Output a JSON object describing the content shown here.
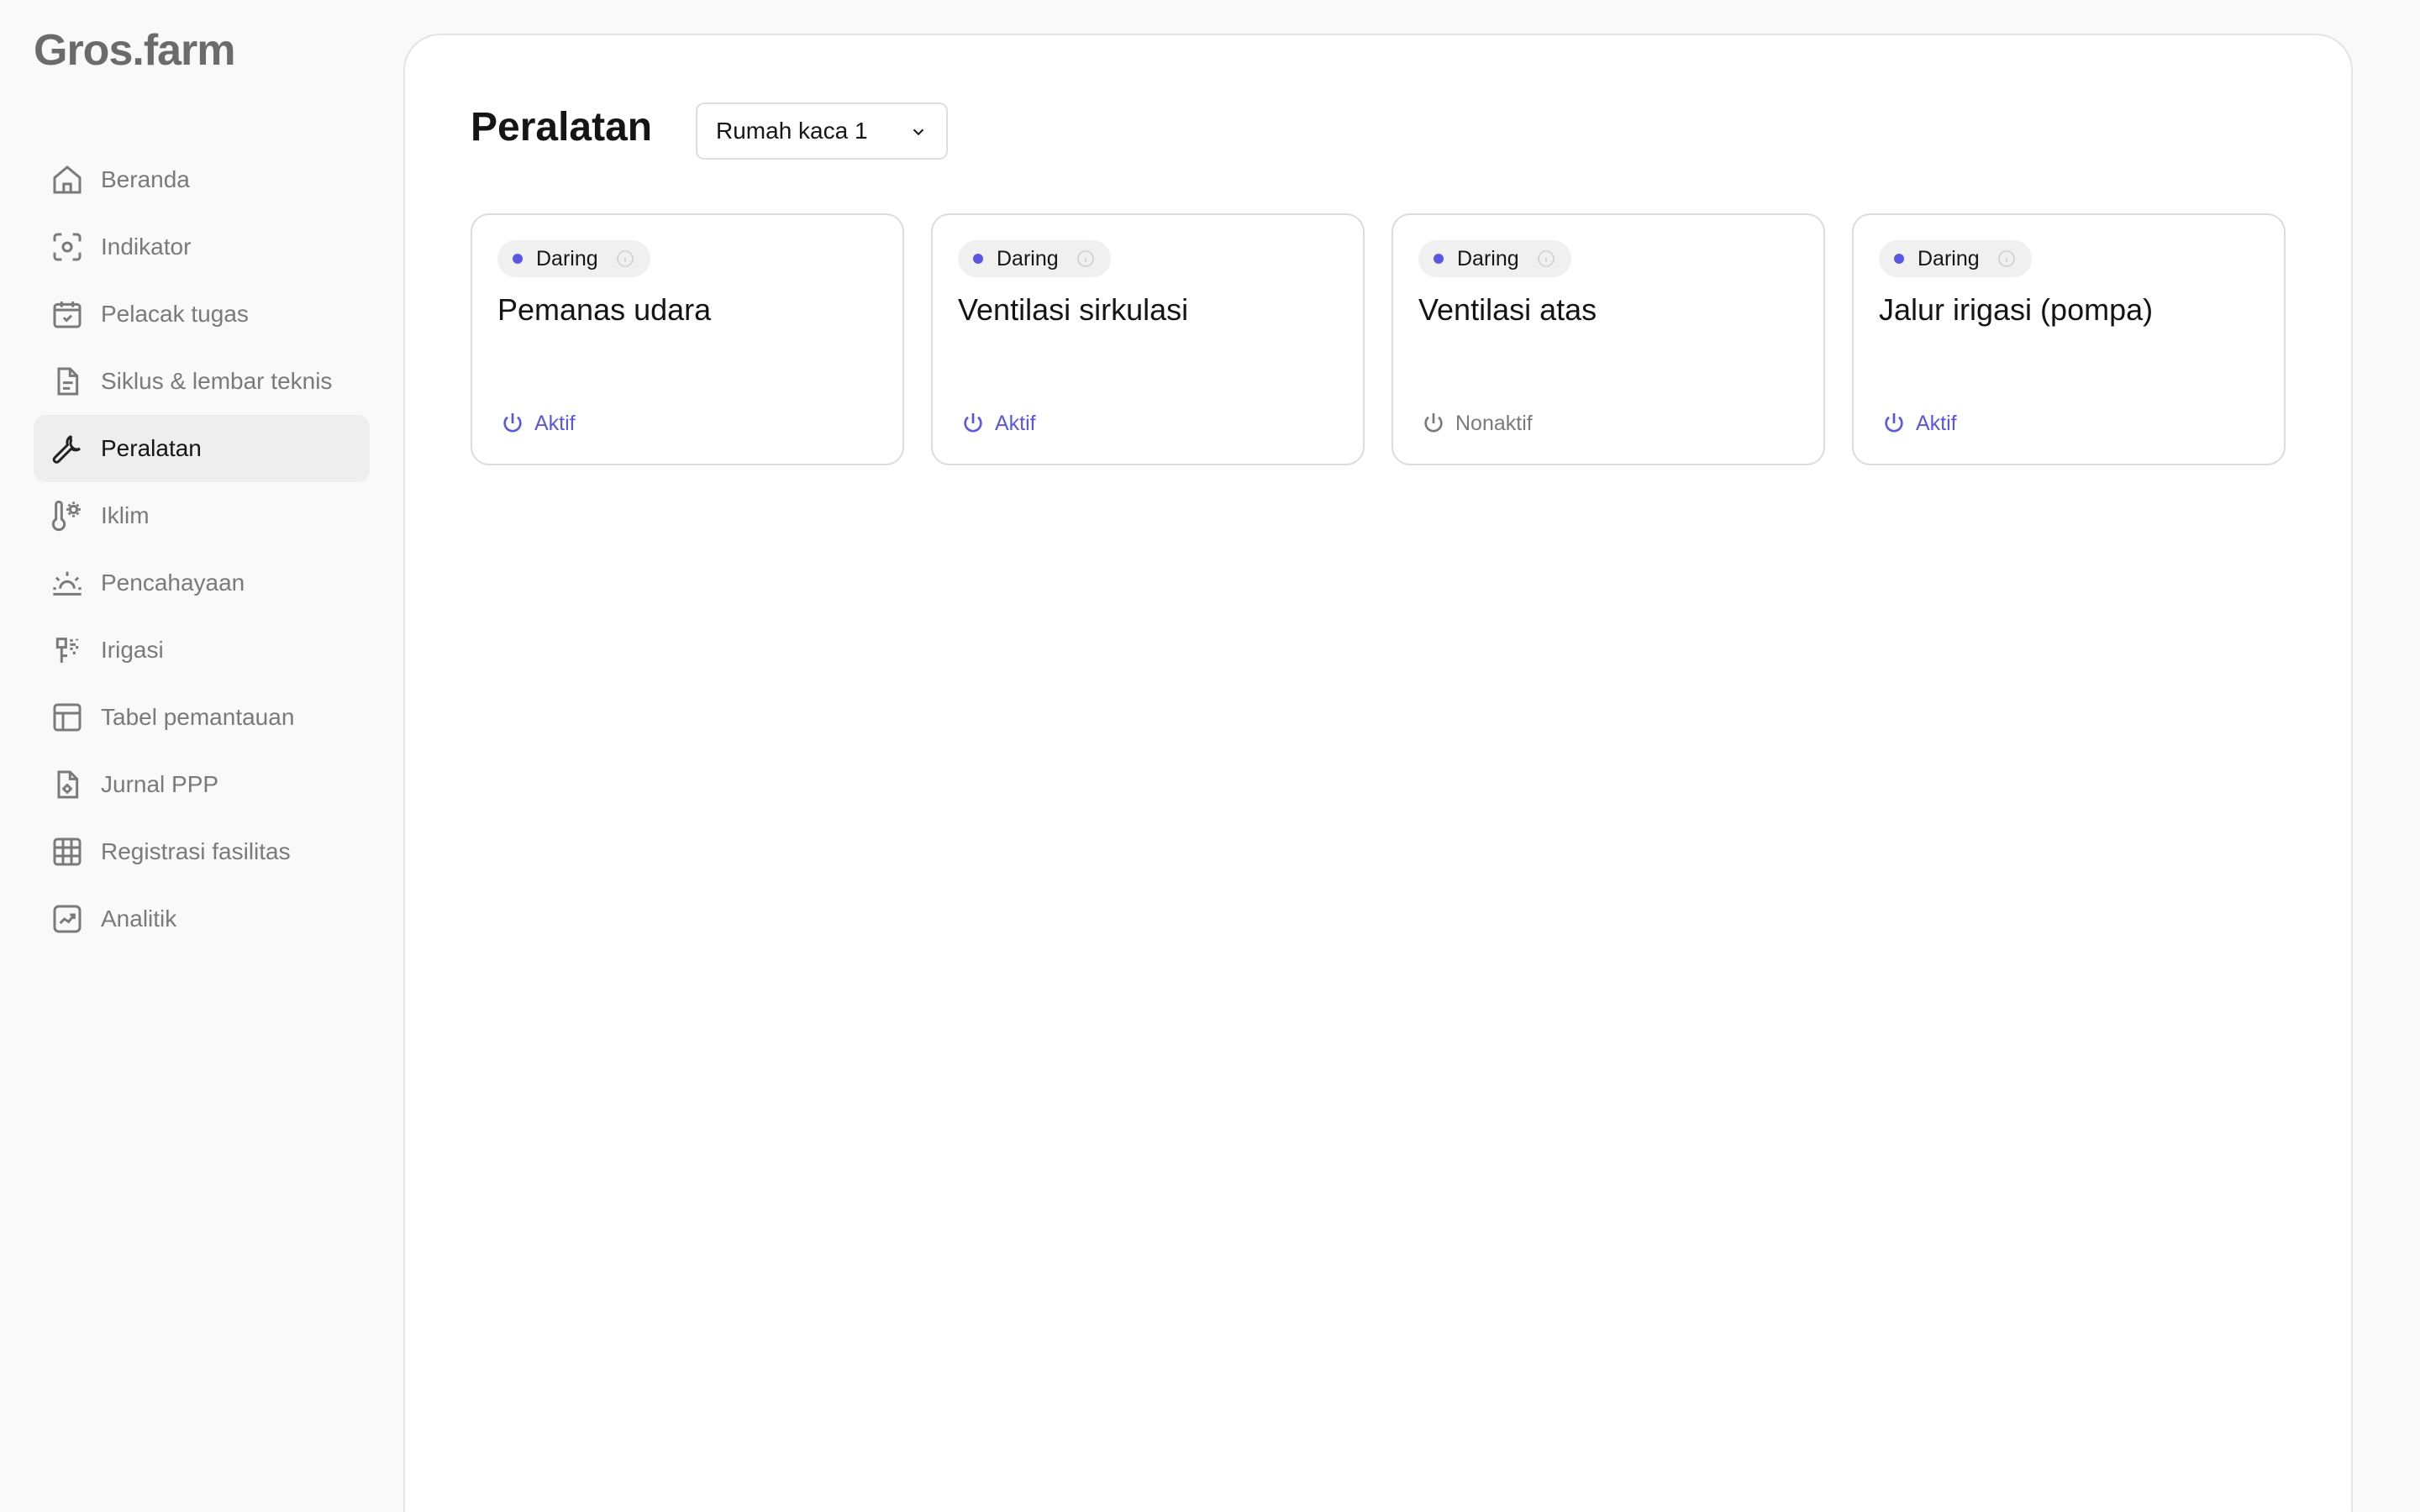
{
  "app": {
    "logo": "Gros.farm"
  },
  "colors": {
    "accent": "#5a57e0",
    "inactive": "#7a7a7a",
    "badge_bg": "#f0f0f0"
  },
  "sidebar": {
    "items": [
      {
        "label": "Beranda",
        "icon": "home-icon",
        "active": false
      },
      {
        "label": "Indikator",
        "icon": "indicator-icon",
        "active": false
      },
      {
        "label": "Pelacak tugas",
        "icon": "calendar-check-icon",
        "active": false
      },
      {
        "label": "Siklus & lembar teknis",
        "icon": "document-icon",
        "active": false
      },
      {
        "label": "Peralatan",
        "icon": "wrench-icon",
        "active": true
      },
      {
        "label": "Iklim",
        "icon": "thermometer-sun-icon",
        "active": false
      },
      {
        "label": "Pencahayaan",
        "icon": "sunrise-icon",
        "active": false
      },
      {
        "label": "Irigasi",
        "icon": "irrigation-icon",
        "active": false
      },
      {
        "label": "Tabel pemantauan",
        "icon": "table-icon",
        "active": false
      },
      {
        "label": "Jurnal PPP",
        "icon": "file-gear-icon",
        "active": false
      },
      {
        "label": "Registrasi fasilitas",
        "icon": "grid-icon",
        "active": false
      },
      {
        "label": "Analitik",
        "icon": "chart-trend-icon",
        "active": false
      }
    ]
  },
  "main": {
    "title": "Peralatan",
    "greenhouse_select": {
      "value": "Rumah kaca 1",
      "icon": "chevron-down-icon"
    },
    "cards": [
      {
        "badge": "Daring",
        "title": "Pemanas udara",
        "status": "Aktif",
        "active": true
      },
      {
        "badge": "Daring",
        "title": "Ventilasi sirkulasi",
        "status": "Aktif",
        "active": true
      },
      {
        "badge": "Daring",
        "title": "Ventilasi atas",
        "status": "Nonaktif",
        "active": false
      },
      {
        "badge": "Daring",
        "title": "Jalur irigasi (pompa)",
        "status": "Aktif",
        "active": true
      }
    ]
  }
}
